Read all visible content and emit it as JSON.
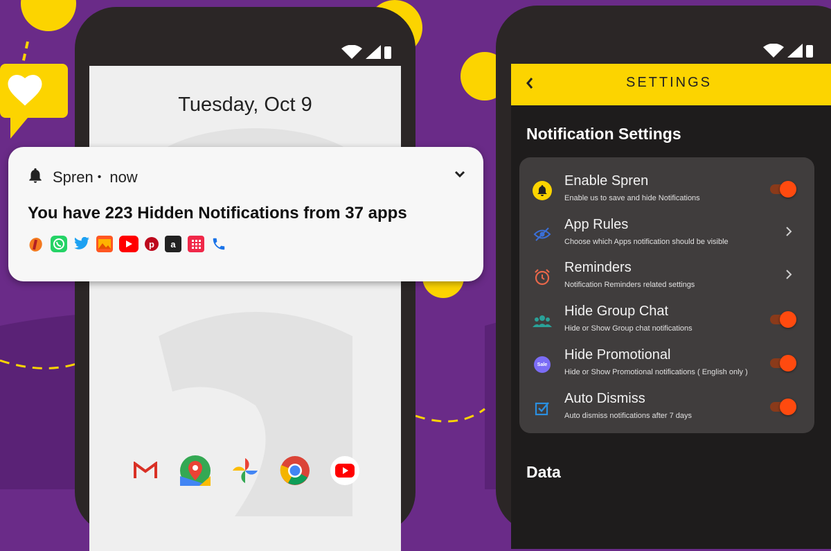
{
  "colors": {
    "background": "#6a2b88",
    "accent_yellow": "#fcd400",
    "toggle_on": "#ff4a0f"
  },
  "lock_screen": {
    "date": "Tuesday, Oct 9",
    "dock_apps": [
      "gmail-icon",
      "google-maps-icon",
      "google-photos-icon",
      "chrome-icon",
      "youtube-icon"
    ]
  },
  "notification": {
    "app_name": "Spren",
    "separator": "•",
    "time": "now",
    "title": "You have 223 Hidden Notifications from 37 apps",
    "app_icons": [
      "icici-icon",
      "whatsapp-icon",
      "twitter-icon",
      "gallery-icon",
      "youtube-icon",
      "pinterest-icon",
      "amazon-icon",
      "calculator-icon",
      "phone-icon"
    ]
  },
  "settings": {
    "title": "SETTINGS",
    "section_title": "Notification Settings",
    "next_section_title": "Data",
    "items": [
      {
        "title": "Enable Spren",
        "subtitle": "Enable us to save and hide Notifications",
        "control": "toggle",
        "on": true,
        "icon": "bell-icon"
      },
      {
        "title": "App Rules",
        "subtitle": "Choose which Apps notification should be visible",
        "control": "arrow",
        "icon": "eye-off-icon"
      },
      {
        "title": "Reminders",
        "subtitle": "Notification Reminders related settings",
        "control": "arrow",
        "icon": "alarm-clock-icon"
      },
      {
        "title": "Hide Group Chat",
        "subtitle": "Hide or Show Group chat notifications",
        "control": "toggle",
        "on": true,
        "icon": "group-icon"
      },
      {
        "title": "Hide Promotional",
        "subtitle": "Hide or Show Promotional notifications ( English only )",
        "control": "toggle",
        "on": true,
        "icon": "sale-badge-icon",
        "icon_text": "Sale"
      },
      {
        "title": "Auto Dismiss",
        "subtitle": "Auto dismiss notifications after 7 days",
        "control": "toggle",
        "on": true,
        "icon": "checkbox-icon"
      }
    ]
  }
}
